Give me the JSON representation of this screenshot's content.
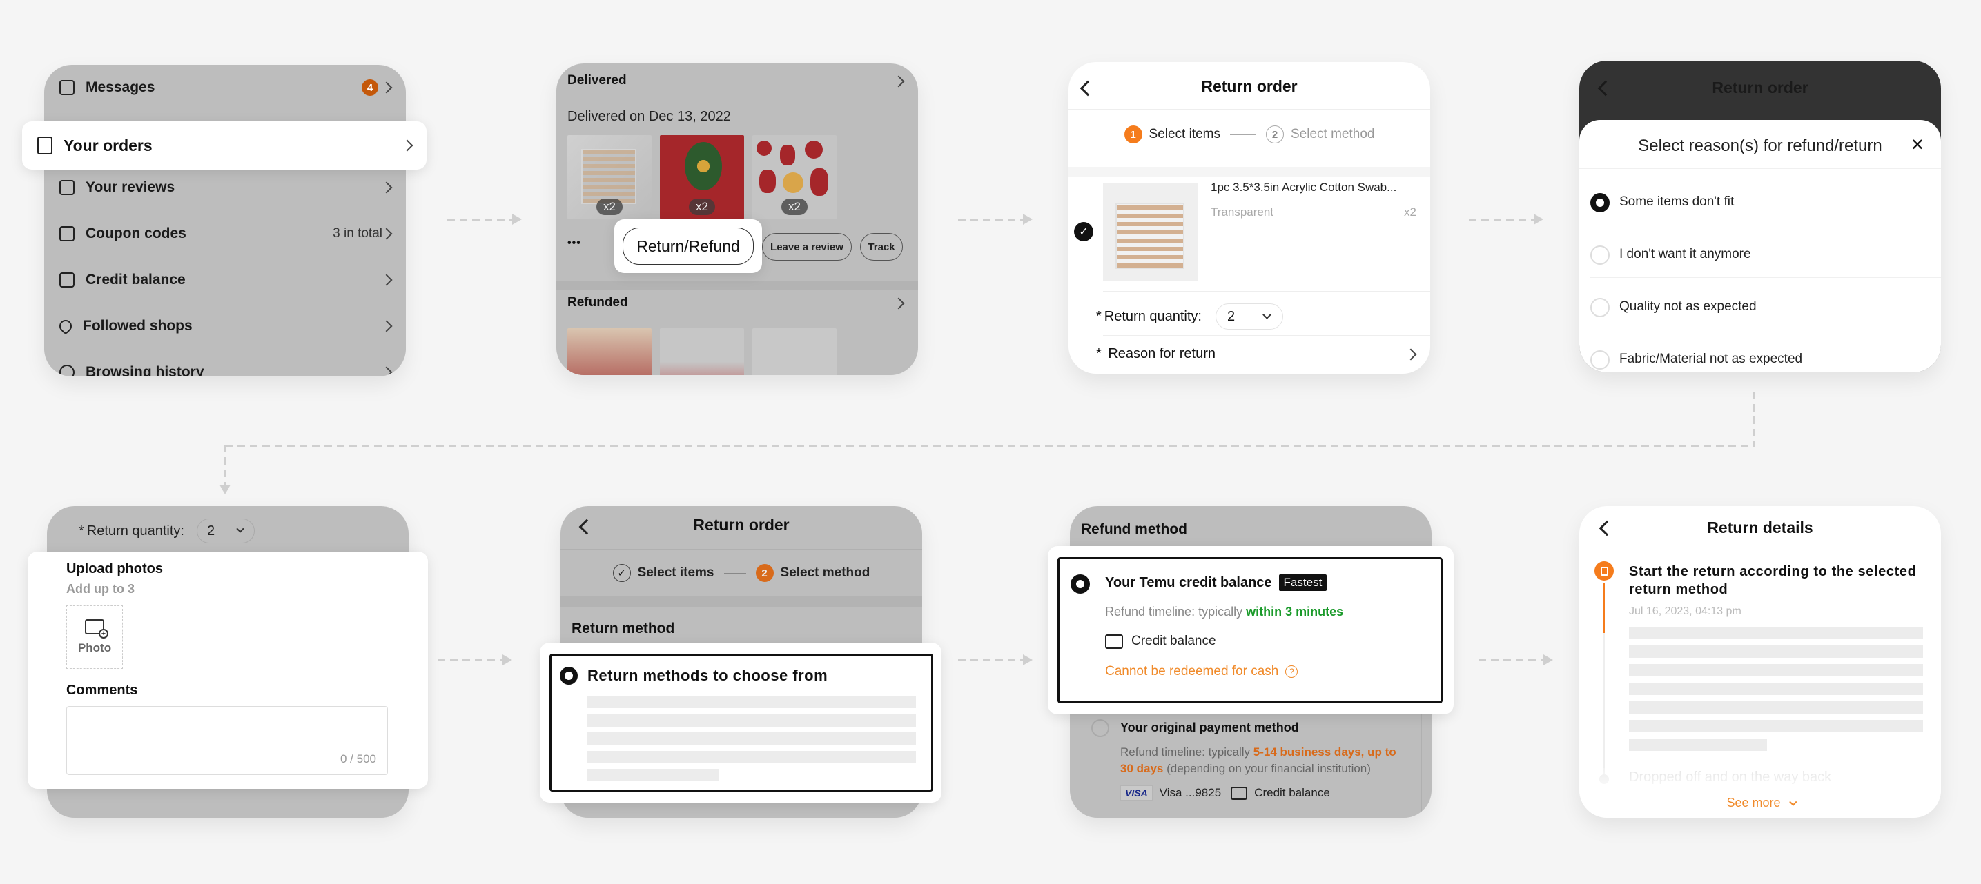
{
  "colors": {
    "accent": "#f57c1c",
    "badge": "#c4580a",
    "success": "#1a9a2a",
    "warning": "#f08a2a",
    "overlay": "#bdbdbd"
  },
  "panel1": {
    "items": [
      {
        "icon": "message-icon",
        "label": "Messages",
        "badge": "4"
      },
      {
        "icon": "order-icon",
        "label": "Your orders"
      },
      {
        "icon": "review-icon",
        "label": "Your reviews"
      },
      {
        "icon": "coupon-icon",
        "label": "Coupon codes",
        "meta": "3 in total"
      },
      {
        "icon": "wallet-icon",
        "label": "Credit balance"
      },
      {
        "icon": "heart-icon",
        "label": "Followed shops"
      },
      {
        "icon": "clock-icon",
        "label": "Browsing history"
      }
    ]
  },
  "panel2": {
    "section1": "Delivered",
    "delivered_on": "Delivered on Dec 13, 2022",
    "thumb_qty": [
      "x2",
      "x2",
      "x2"
    ],
    "more": "•••",
    "return_refund": "Return/Refund",
    "leave_review": "Leave a review",
    "track": "Track",
    "section2": "Refunded"
  },
  "panel3": {
    "title": "Return order",
    "step1_num": "1",
    "step1": "Select items",
    "step2_num": "2",
    "step2": "Select method",
    "product_name": "1pc 3.5*3.5in Acrylic Cotton Swab...",
    "variant": "Transparent",
    "qty": "x2",
    "return_qty_label": "Return quantity:",
    "return_qty_value": "2",
    "reason_label": "Reason for return",
    "required_mark": "*"
  },
  "panel4": {
    "title": "Return order",
    "sheet_title": "Select reason(s) for refund/return",
    "close": "✕",
    "reasons": [
      {
        "label": "Some items don't fit",
        "selected": true
      },
      {
        "label": "I don't want it anymore",
        "selected": false
      },
      {
        "label": "Quality not as expected",
        "selected": false
      },
      {
        "label": "Fabric/Material not as expected",
        "selected": false
      }
    ]
  },
  "panel5": {
    "required_mark": "*",
    "return_qty_label": "Return quantity:",
    "return_qty_value": "2",
    "upload_title": "Upload photos",
    "upload_hint": "Add up to 3",
    "photo_label": "Photo",
    "comments_title": "Comments",
    "comments_value": "",
    "counter": "0 / 500"
  },
  "panel6": {
    "title": "Return order",
    "step1": "Select items",
    "step2_num": "2",
    "step2": "Select method",
    "section": "Return method",
    "option": "Return methods to choose from"
  },
  "panel7": {
    "section": "Refund method",
    "opt1_title": "Your Temu credit balance",
    "opt1_tag": "Fastest",
    "opt1_timeline_prefix": "Refund timeline: typically ",
    "opt1_timeline_value": "within 3 minutes",
    "opt1_dest": "Credit balance",
    "opt1_warning": "Cannot be redeemed for cash",
    "opt2_title": "Your original payment method",
    "opt2_timeline_prefix": "Refund timeline: typically ",
    "opt2_timeline_value": "5-14 business days, up to 30 days",
    "opt2_timeline_suffix": " (depending on your financial institution)",
    "visa_logo": "VISA",
    "visa_label": "Visa ...9825",
    "opt2_dest": "Credit balance"
  },
  "panel8": {
    "title": "Return details",
    "step_title": "Start the return according to the selected return method",
    "step_time": "Jul 16, 2023, 04:13 pm",
    "next_step": "Dropped off and on the way back",
    "see_more": "See more"
  }
}
